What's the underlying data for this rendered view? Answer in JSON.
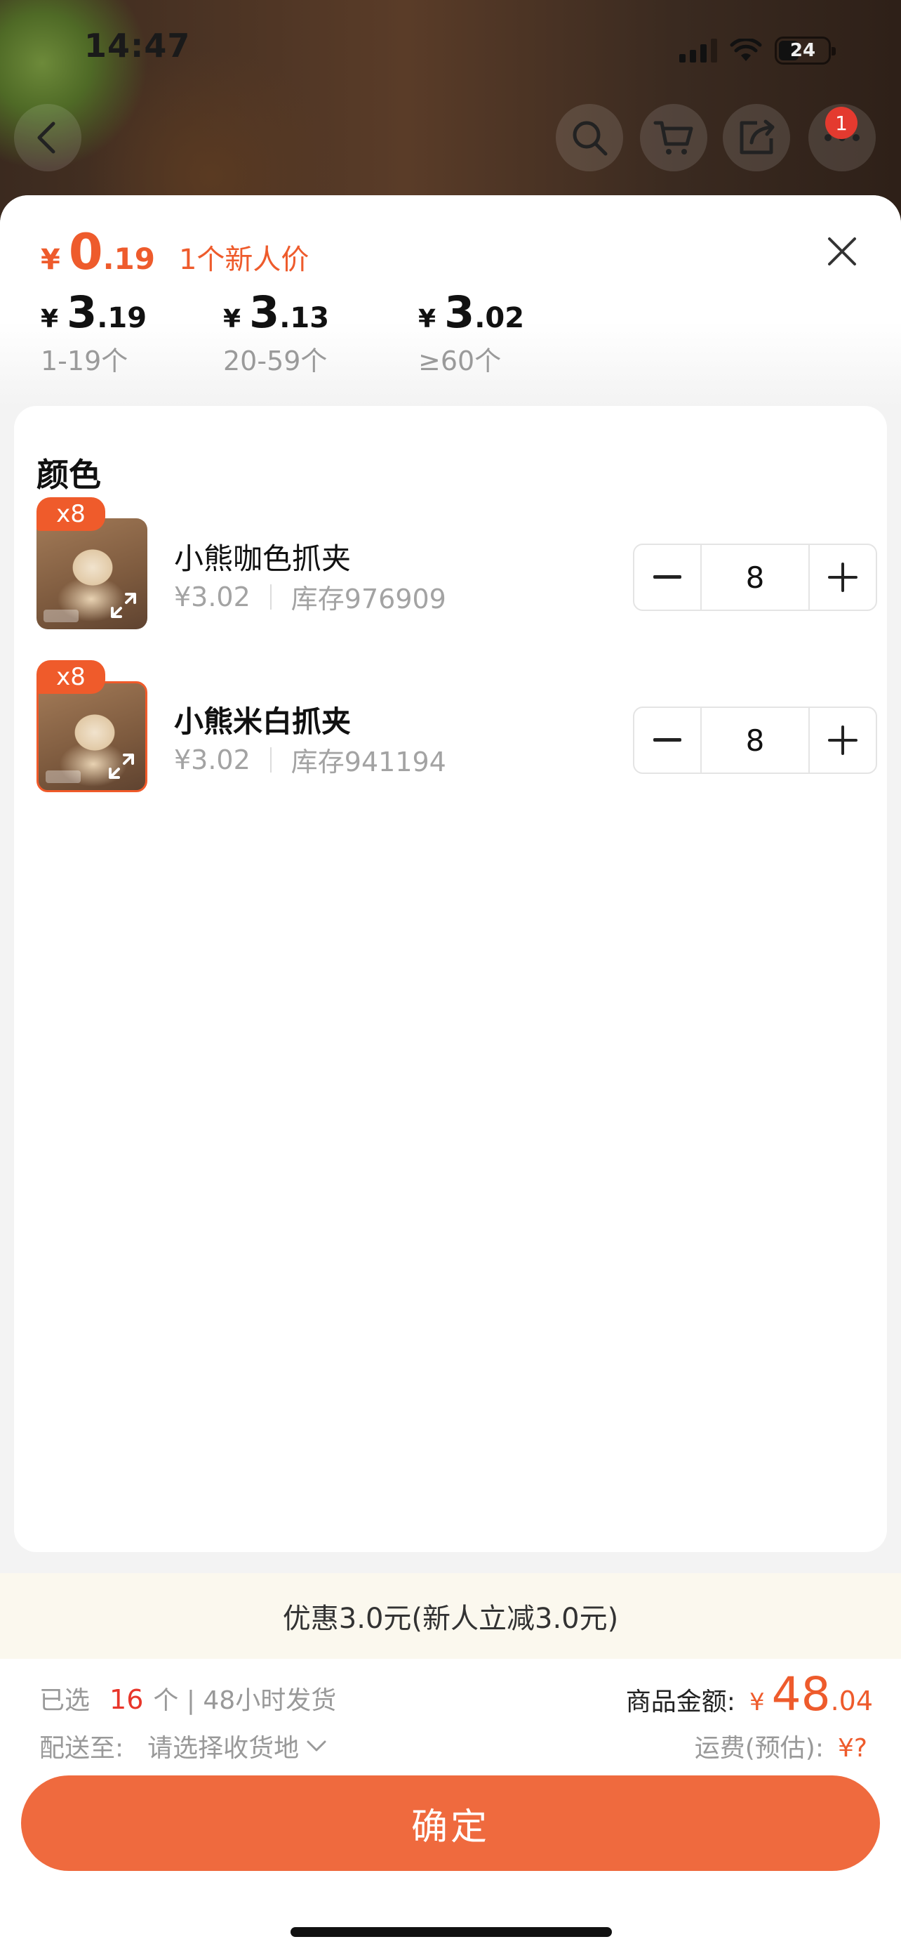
{
  "status_bar": {
    "time": "14:47",
    "battery": "24"
  },
  "nav": {
    "message_badge": "1"
  },
  "promo": {
    "currency": "¥",
    "price_int": "0",
    "price_dec": ".19",
    "label": "1个新人价"
  },
  "tiers": [
    {
      "currency": "¥",
      "price_int": "3",
      "price_dec": ".19",
      "range": "1-19个"
    },
    {
      "currency": "¥",
      "price_int": "3",
      "price_dec": ".13",
      "range": "20-59个"
    },
    {
      "currency": "¥",
      "price_int": "3",
      "price_dec": ".02",
      "range": "≥60个"
    }
  ],
  "section_title": "颜色",
  "skus": [
    {
      "badge": "x8",
      "name": "小熊咖色抓夹",
      "price": "¥3.02",
      "stock": "库存976909",
      "quantity": "8"
    },
    {
      "badge": "x8",
      "name": "小熊米白抓夹",
      "price": "¥3.02",
      "stock": "库存941194",
      "quantity": "8"
    }
  ],
  "discount": "优惠3.0元(新人立减3.0元)",
  "footer": {
    "selected_prefix": "已选",
    "selected_count": "16",
    "selected_suffix": "个 | 48小时发货",
    "ship_label": "配送至:",
    "ship_value": "请选择收货地",
    "amount_label": "商品金额:",
    "amount_currency": "¥",
    "amount_int": "48",
    "amount_dec": ".04",
    "freight_label": "运费(预估):",
    "freight_value": "¥?",
    "confirm_label": "确定"
  },
  "colors": {
    "accent": "#ef6a3e",
    "price_red": "#ee5b2c"
  }
}
